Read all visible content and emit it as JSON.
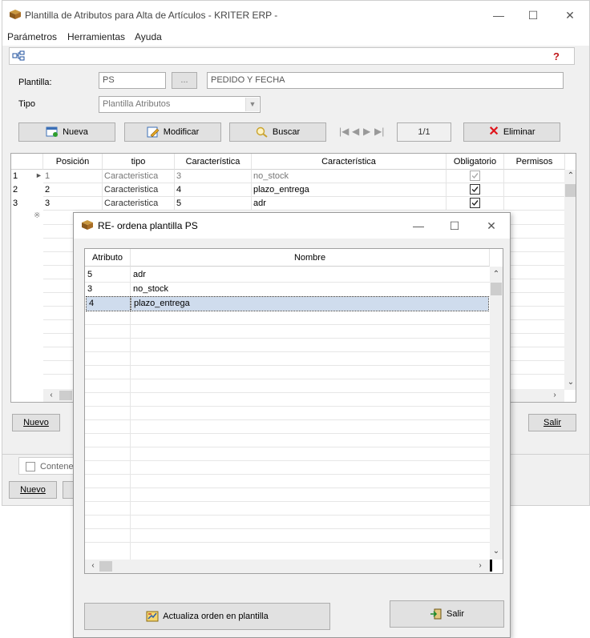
{
  "main_window": {
    "title": "Plantilla de Atributos para Alta de Artículos - KRITER ERP -",
    "menu": [
      "Parámetros",
      "Herramientas",
      "Ayuda"
    ],
    "form": {
      "plantilla_label": "Plantilla:",
      "plantilla_code": "PS",
      "browse_button": "...",
      "plantilla_desc": "PEDIDO Y FECHA",
      "tipo_label": "Tipo",
      "tipo_value": "Plantilla Atributos"
    },
    "buttons": {
      "nueva": "Nueva",
      "modificar": "Modificar",
      "buscar": "Buscar",
      "record_pos": "1/1",
      "eliminar": "Eliminar"
    },
    "grid": {
      "headers": [
        "Posición",
        "tipo",
        "Característica",
        "Característica",
        "Obligatorio",
        "Permisos"
      ],
      "rows": [
        {
          "num": "1",
          "pos": "1",
          "tipo": "Caracteristica",
          "car_id": "3",
          "car_name": "no_stock",
          "obligatorio": true,
          "disabled": true
        },
        {
          "num": "2",
          "pos": "2",
          "tipo": "Caracteristica",
          "car_id": "4",
          "car_name": "plazo_entrega",
          "obligatorio": true,
          "disabled": false
        },
        {
          "num": "3",
          "pos": "3",
          "tipo": "Caracteristica",
          "car_id": "5",
          "car_name": "adr",
          "obligatorio": true,
          "disabled": false
        }
      ]
    },
    "nuevo_button": "Nuevo",
    "salir_button": "Salir",
    "contenedor_label": "Contene",
    "nuevo_button_2": "Nuevo"
  },
  "dialog": {
    "title": "RE- ordena plantilla PS",
    "headers": [
      "Atributo",
      "Nombre"
    ],
    "rows": [
      {
        "atributo": "5",
        "nombre": "adr"
      },
      {
        "atributo": "3",
        "nombre": "no_stock"
      },
      {
        "atributo": "4",
        "nombre": "plazo_entrega"
      }
    ],
    "selected_index": 2,
    "actualiza_button": "Actualiza orden en plantilla",
    "salir_button": "Salir"
  }
}
